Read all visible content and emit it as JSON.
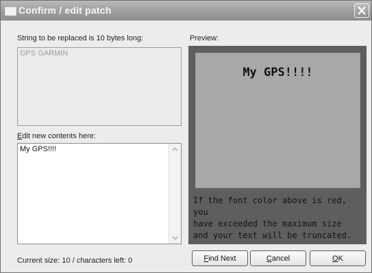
{
  "window": {
    "title": "Confirm / edit patch",
    "close_icon": "close-icon",
    "window_icon": "window-icon"
  },
  "original": {
    "label": "String to be replaced is 10 bytes long:",
    "value": "GPS GARMIN"
  },
  "edit": {
    "label_accel": "E",
    "label_rest": "dit new contents here:",
    "value": "My GPS!!!!"
  },
  "status": {
    "text": "Current size: 10 / characters left: 0"
  },
  "preview": {
    "label": "Preview:",
    "title": "My GPS!!!!",
    "warning_line1": "If the font color above is red, you",
    "warning_line2": "have exceeded the maximum size",
    "warning_line3": "and your text will be truncated.",
    "frame_color": "#5e5e5e",
    "screen_color": "#a8a8a8"
  },
  "buttons": {
    "find_next_accel": "F",
    "find_next_rest": "ind Next",
    "cancel_accel": "C",
    "cancel_rest": "ancel",
    "ok_accel": "O",
    "ok_rest": "K"
  }
}
